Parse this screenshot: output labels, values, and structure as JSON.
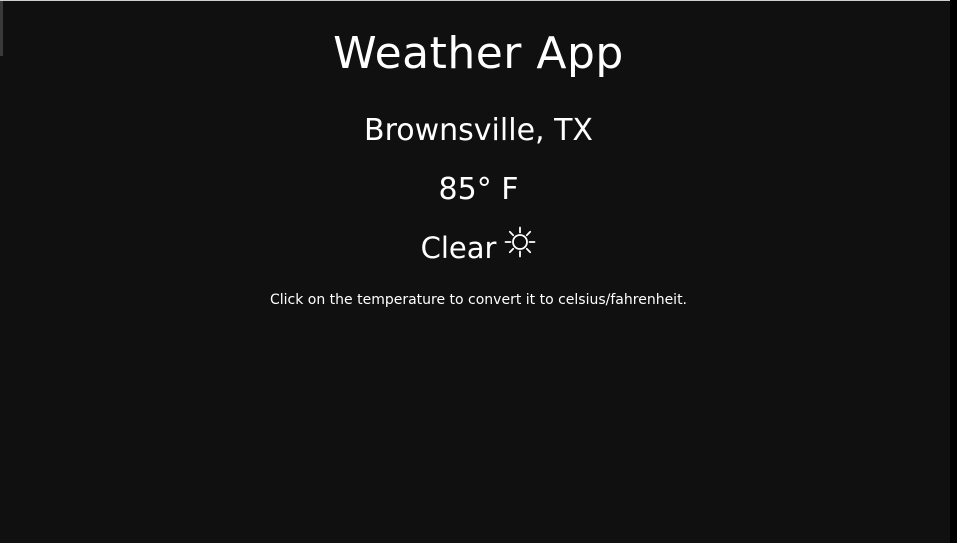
{
  "app": {
    "title": "Weather App"
  },
  "weather": {
    "location": "Brownsville, TX",
    "temperature": "85° F",
    "condition": "Clear",
    "condition_icon": "sun-icon"
  },
  "hint": {
    "text": "Click on the temperature to convert it to celsius/fahrenheit."
  },
  "colors": {
    "background": "#101010",
    "text": "#ffffff"
  }
}
